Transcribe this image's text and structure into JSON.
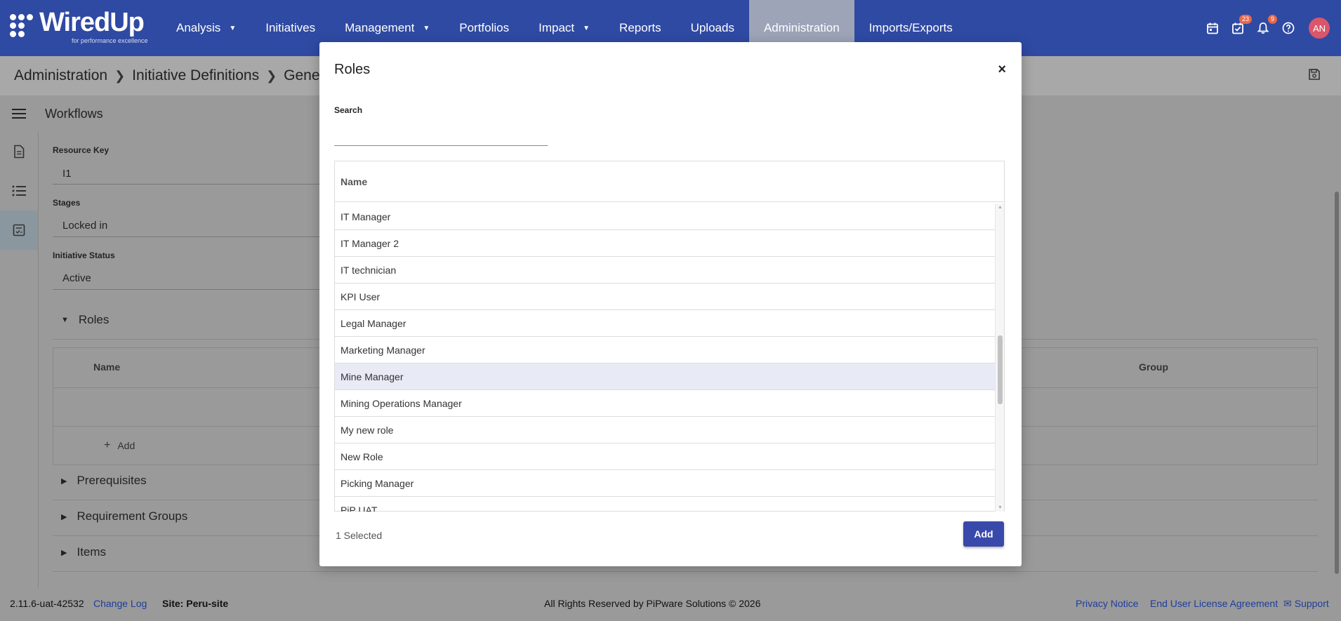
{
  "app": {
    "logo_text": "WiredUp",
    "logo_tagline": "for performance excellence"
  },
  "nav": {
    "items": [
      {
        "label": "Analysis",
        "dropdown": true
      },
      {
        "label": "Initiatives",
        "dropdown": false
      },
      {
        "label": "Management",
        "dropdown": true
      },
      {
        "label": "Portfolios",
        "dropdown": false
      },
      {
        "label": "Impact",
        "dropdown": true
      },
      {
        "label": "Reports",
        "dropdown": false
      },
      {
        "label": "Uploads",
        "dropdown": false
      },
      {
        "label": "Administration",
        "dropdown": false,
        "active": true
      },
      {
        "label": "Imports/Exports",
        "dropdown": false
      }
    ],
    "tasks_badge": "23",
    "notifications_badge": "9",
    "avatar_initials": "AN"
  },
  "breadcrumb": {
    "items": [
      "Administration",
      "Initiative Definitions",
      "General I"
    ]
  },
  "workflow": {
    "title": "Workflows"
  },
  "form": {
    "resource_key_label": "Resource Key",
    "resource_key_value": "I1",
    "stages_label": "Stages",
    "stages_value": "Locked in",
    "status_label": "Initiative Status",
    "status_value": "Active",
    "roles_section": "Roles",
    "roles_table": {
      "col_name": "Name",
      "col_group": "Group",
      "add_label": "Add"
    },
    "prerequisites_section": "Prerequisites",
    "requirement_groups_section": "Requirement Groups",
    "items_section": "Items"
  },
  "modal": {
    "title": "Roles",
    "close_label": "×",
    "search_label": "Search",
    "search_value": "",
    "column_name": "Name",
    "rows": [
      {
        "name": "IT Manager",
        "selected": false
      },
      {
        "name": "IT Manager 2",
        "selected": false
      },
      {
        "name": "IT technician",
        "selected": false
      },
      {
        "name": "KPI User",
        "selected": false
      },
      {
        "name": "Legal Manager",
        "selected": false
      },
      {
        "name": "Marketing Manager",
        "selected": false
      },
      {
        "name": "Mine Manager",
        "selected": true
      },
      {
        "name": "Mining Operations Manager",
        "selected": false
      },
      {
        "name": "My new role",
        "selected": false
      },
      {
        "name": "New Role",
        "selected": false
      },
      {
        "name": "Picking Manager",
        "selected": false
      },
      {
        "name": "PiP UAT",
        "selected": false
      }
    ],
    "selected_count": "1 Selected",
    "add_button": "Add"
  },
  "footer": {
    "version": "2.11.6-uat-42532",
    "change_log": "Change Log",
    "site": "Site: Peru-site",
    "copyright": "All Rights Reserved by PiPware Solutions © 2026",
    "privacy": "Privacy Notice",
    "eula": "End User License Agreement",
    "support": "Support"
  }
}
